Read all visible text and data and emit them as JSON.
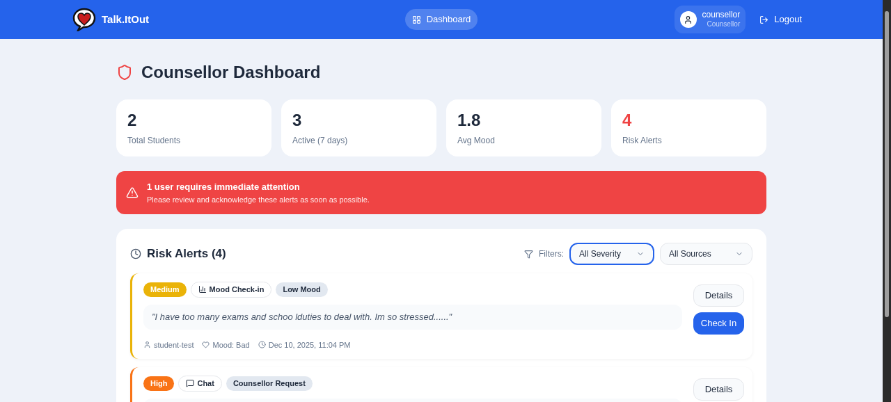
{
  "header": {
    "brand": "Talk.ItOut",
    "nav": [
      {
        "label": "Dashboard",
        "selected": true
      }
    ],
    "user": {
      "name": "counsellor",
      "role": "Counsellor"
    },
    "logout": "Logout"
  },
  "page_title": "Counsellor Dashboard",
  "stats": [
    {
      "value": "2",
      "label": "Total Students",
      "color": "#1e293b"
    },
    {
      "value": "3",
      "label": "Active (7 days)",
      "color": "#1e293b"
    },
    {
      "value": "1.8",
      "label": "Avg Mood",
      "color": "#1e293b"
    },
    {
      "value": "4",
      "label": "Risk Alerts",
      "color": "#ef4444"
    }
  ],
  "banner": {
    "title": "1 user requires immediate attention",
    "message": "Please review and acknowledge these alerts as soon as possible."
  },
  "risk_alerts": {
    "title": "Risk Alerts (4)",
    "filters_label": "Filters:",
    "filters": [
      {
        "value": "All Severity",
        "focused": true
      },
      {
        "value": "All Sources",
        "focused": false
      }
    ],
    "alerts": [
      {
        "severity": "Medium",
        "color": "#eab308",
        "source": {
          "kind": "mood",
          "label": "Mood Check-in"
        },
        "reason": "Low Mood",
        "quote": "\"I have too many exams and schoo lduties to deal with. Im so stressed......\"",
        "student": "student-test",
        "mood": "Mood: Bad",
        "time": "Dec 10, 2025, 11:04 PM",
        "actions": [
          "Details",
          "Check In"
        ]
      },
      {
        "severity": "High",
        "color": "#f97316",
        "source": {
          "kind": "chat",
          "label": "Chat"
        },
        "reason": "Counsellor Request",
        "actions": [
          "Details"
        ]
      }
    ]
  }
}
